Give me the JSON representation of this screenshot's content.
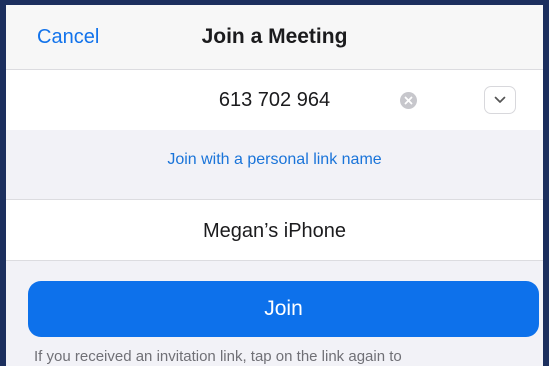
{
  "navbar": {
    "cancel_label": "Cancel",
    "title": "Join a Meeting"
  },
  "meeting": {
    "id_value": "613 702 964",
    "clear_icon": "clear-icon",
    "dropdown_icon": "chevron-down-icon"
  },
  "personal_link": {
    "label": "Join with a personal link name"
  },
  "name_field": {
    "value": "Megan’s iPhone"
  },
  "join": {
    "label": "Join"
  },
  "help": {
    "text": "If you received an invitation link, tap on the link again to"
  },
  "colors": {
    "accent": "#0d71eb",
    "link": "#1a74d9",
    "frame": "#1c2f5e"
  }
}
